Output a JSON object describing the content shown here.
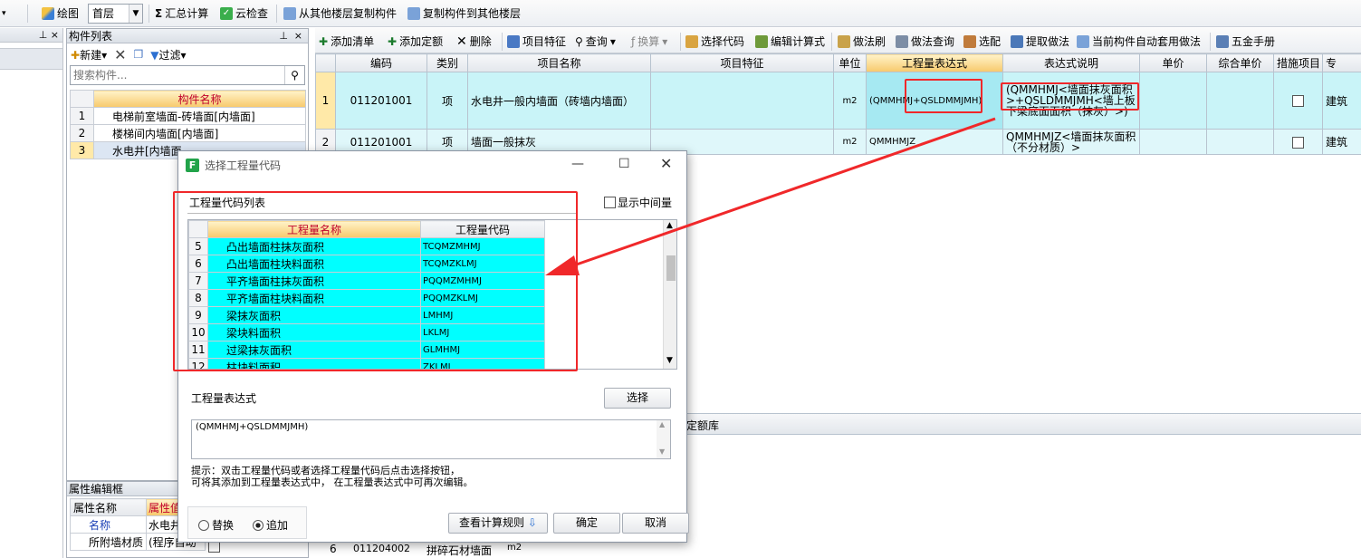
{
  "toolbar": {
    "draw_label": "绘图",
    "floor_value": "首层",
    "sum_label": "汇总计算",
    "cloud_check_label": "云检查",
    "copy_from_label": "从其他楼层复制构件",
    "copy_to_label": "复制构件到其他楼层"
  },
  "comp_panel": {
    "title": "构件列表",
    "new_label": "新建",
    "filter_label": "过滤",
    "search_placeholder": "搜索构件...",
    "col_name": "构件名称",
    "rows": [
      {
        "num": "1",
        "name": "电梯前室墙面-砖墙面[内墙面]"
      },
      {
        "num": "2",
        "name": "楼梯间内墙面[内墙面]"
      },
      {
        "num": "3",
        "name": "水电井[内墙面"
      }
    ]
  },
  "attr_panel": {
    "title": "属性编辑框",
    "col_name": "属性名称",
    "col_value": "属性值",
    "rows": [
      {
        "name": "名称",
        "value": "水电井"
      },
      {
        "name": "所附墙材质",
        "value": "(程序自动"
      }
    ]
  },
  "main_toolbar": {
    "items": [
      "添加清单",
      "添加定额",
      "删除",
      "项目特征",
      "查询",
      "换算",
      "选择代码",
      "编辑计算式",
      "做法刷",
      "做法查询",
      "选配",
      "提取做法",
      "当前构件自动套用做法",
      "五金手册"
    ]
  },
  "main_table": {
    "headers": [
      "编码",
      "类别",
      "项目名称",
      "项目特征",
      "单位",
      "工程量表达式",
      "表达式说明",
      "单价",
      "综合单价",
      "措施项目",
      "专"
    ],
    "rows": [
      {
        "num": "1",
        "code": "011201001",
        "type": "项",
        "name": "水电井一般内墙面（砖墙内墙面）",
        "unit": "m2",
        "expr": "(QMMHMJ+QSLDMMJMH)",
        "desc": "(QMMHMJ<墙面抹灰面积>+QSLDMMJMH<墙上板下梁底面面积（抹灰）>)",
        "tail": "建筑"
      },
      {
        "num": "2",
        "code": "011201001",
        "type": "项",
        "name": "墙面一般抹灰",
        "unit": "m2",
        "expr": "QMMHMJZ",
        "desc": "QMMHMJZ<墙面抹灰面积（不分材质）>",
        "tail": "建筑"
      }
    ]
  },
  "lower_strip_label": "定额库",
  "bottom_row": {
    "num": "6",
    "code": "011204002",
    "name": "拼碎石材墙面",
    "unit": "m2"
  },
  "dialog": {
    "title": "选择工程量代码",
    "list_label": "工程量代码列表",
    "show_mid_label": "显示中间量",
    "col_name": "工程量名称",
    "col_code": "工程量代码",
    "rows": [
      {
        "num": "5",
        "name": "凸出墙面柱抹灰面积",
        "code": "TCQMZMHMJ"
      },
      {
        "num": "6",
        "name": "凸出墙面柱块料面积",
        "code": "TCQMZKLMJ"
      },
      {
        "num": "7",
        "name": "平齐墙面柱抹灰面积",
        "code": "PQQMZMHMJ"
      },
      {
        "num": "8",
        "name": "平齐墙面柱块料面积",
        "code": "PQQMZKLMJ"
      },
      {
        "num": "9",
        "name": "梁抹灰面积",
        "code": "LMHMJ"
      },
      {
        "num": "10",
        "name": "梁块料面积",
        "code": "LKLMJ"
      },
      {
        "num": "11",
        "name": "过梁抹灰面积",
        "code": "GLMHMJ"
      },
      {
        "num": "12",
        "name": "柱块料面积",
        "code": "ZKLMJ"
      }
    ],
    "expr_label": "工程量表达式",
    "select_button": "选择",
    "expr_value": "(QMMHMJ+QSLDMMJMH)",
    "hint": "提示：双击工程量代码或者选择工程量代码后点击选择按钮，\n可将其添加到工程量表达式中， 在工程量表达式中可再次编辑。",
    "replace_label": "替换",
    "append_label": "追加",
    "rules_button": "查看计算规则",
    "ok_button": "确定",
    "cancel_button": "取消"
  },
  "colors": {
    "cyan": "#00ffff",
    "highlight_red": "#f0282a",
    "header_orange": "#f7c96b"
  }
}
